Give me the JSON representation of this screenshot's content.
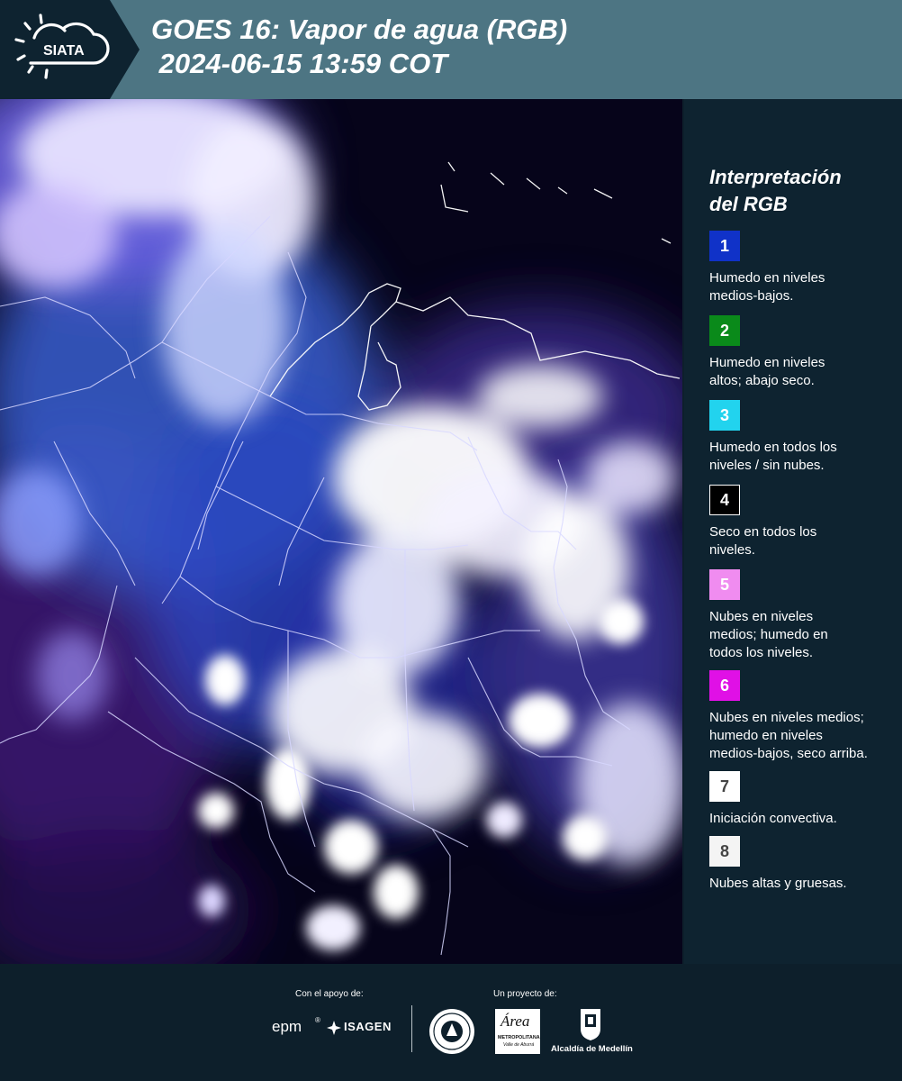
{
  "header": {
    "title_line1": "GOES 16: Vapor de agua (RGB)",
    "title_line2": " 2024-06-15 13:59 COT",
    "logo_text": "SIATA",
    "logo_icon": "sun-cloud-icon"
  },
  "legend": {
    "title": "Interpretación\ndel RGB",
    "items": [
      {
        "number": "1",
        "color": "#1032c8",
        "text": "Humedo en niveles\nmedios-bajos."
      },
      {
        "number": "2",
        "color": "#0a8a1a",
        "text": "Humedo en niveles\naltos; abajo seco."
      },
      {
        "number": "3",
        "color": "#22d3ee",
        "text": "Humedo en todos los\nniveles / sin nubes."
      },
      {
        "number": "4",
        "color": "#000000",
        "text": "Seco en todos los\nniveles."
      },
      {
        "number": "5",
        "color": "#f08cf0",
        "text": "Nubes en niveles\nmedios; humedo en\ntodos los niveles."
      },
      {
        "number": "6",
        "color": "#e010e6",
        "text": "Nubes en niveles medios;\nhumedo en niveles\nmedios-bajos, seco arriba."
      },
      {
        "number": "7",
        "color": "#ffffff",
        "text": "Iniciación convectiva."
      },
      {
        "number": "8",
        "color": "#f4f4f4",
        "text": "Nubes altas y gruesas."
      }
    ]
  },
  "footer": {
    "support_label": "Con el apoyo de:",
    "project_label": "Un proyecto de:",
    "epm": "epm",
    "isagen": "ISAGEN",
    "area_line1": "Área",
    "area_line2": "METROPOLITANA",
    "area_line3": "Valle de Aburrá",
    "alcaldia": "Alcaldía de Medellín"
  }
}
